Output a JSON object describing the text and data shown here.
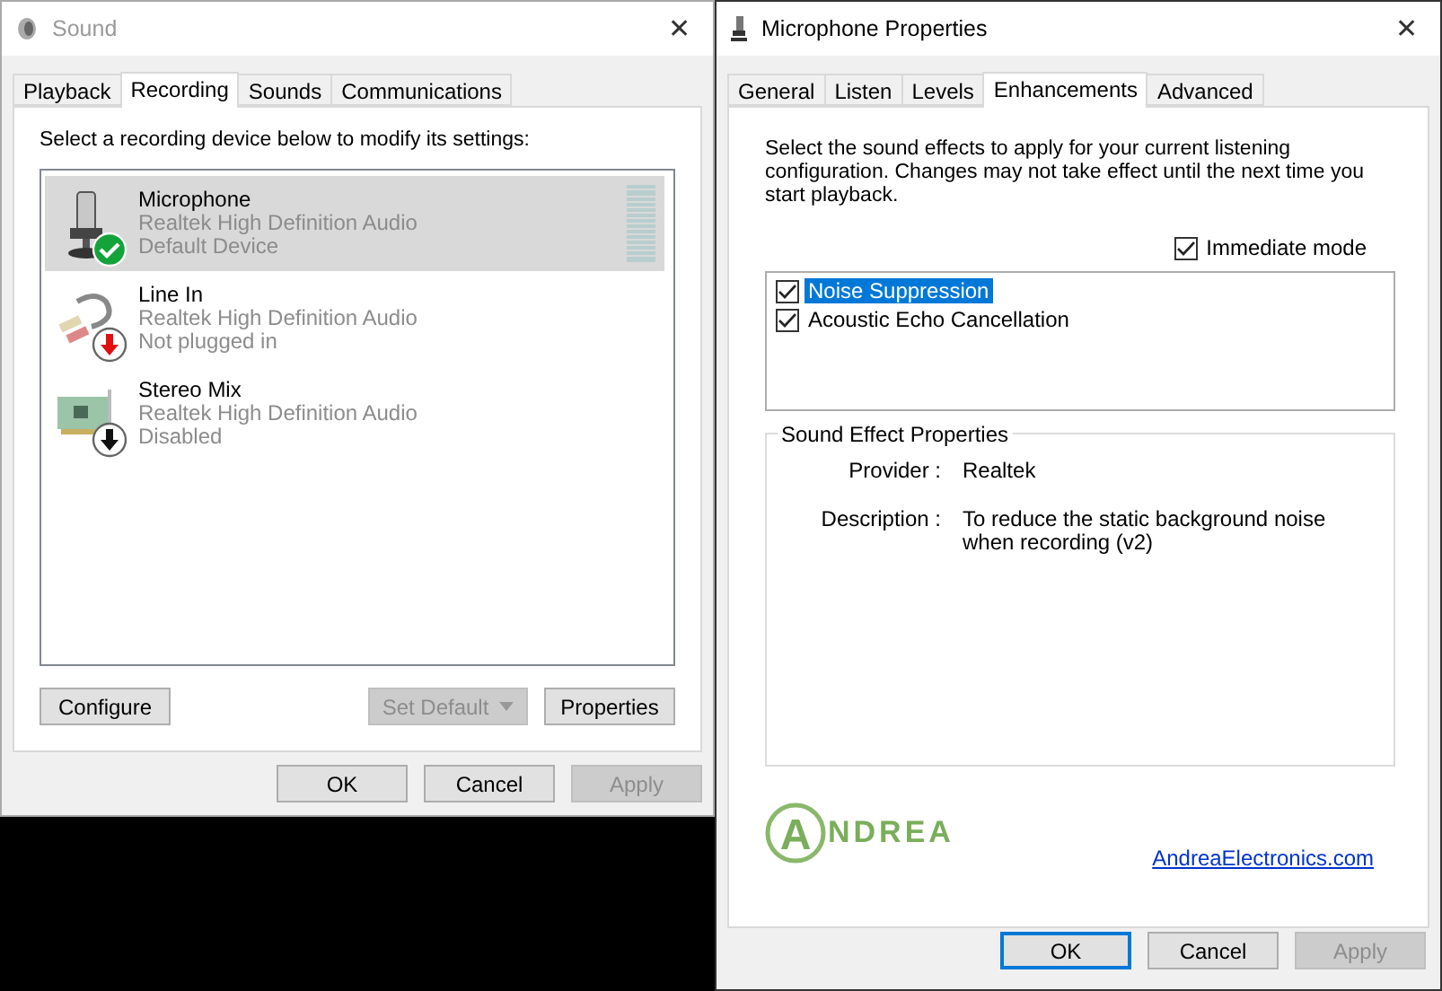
{
  "sound_window": {
    "title": "Sound",
    "close": "✕",
    "tabs": [
      {
        "label": "Playback",
        "selected": false
      },
      {
        "label": "Recording",
        "selected": true
      },
      {
        "label": "Sounds",
        "selected": false
      },
      {
        "label": "Communications",
        "selected": false
      }
    ],
    "instruction": "Select a recording device below to modify its settings:",
    "devices": [
      {
        "name": "Microphone",
        "driver": "Realtek High Definition Audio",
        "status": "Default Device",
        "kind": "microphone",
        "default": true,
        "unplugged": false,
        "disabled": false,
        "selected": true
      },
      {
        "name": "Line In",
        "driver": "Realtek High Definition Audio",
        "status": "Not plugged in",
        "kind": "line",
        "default": false,
        "unplugged": true,
        "disabled": false,
        "selected": false
      },
      {
        "name": "Stereo Mix",
        "driver": "Realtek High Definition Audio",
        "status": "Disabled",
        "kind": "card",
        "default": false,
        "unplugged": false,
        "disabled": true,
        "selected": false
      }
    ],
    "list_buttons": [
      {
        "label": "Configure",
        "disabled": false,
        "kind": "plain"
      },
      {
        "label": "Set Default",
        "disabled": true,
        "kind": "split"
      },
      {
        "label": "Properties",
        "disabled": false,
        "kind": "plain"
      }
    ],
    "buttons": [
      {
        "label": "OK",
        "disabled": false,
        "default": false
      },
      {
        "label": "Cancel",
        "disabled": false,
        "default": false
      },
      {
        "label": "Apply",
        "disabled": true,
        "default": false
      }
    ]
  },
  "properties_window": {
    "title": "Microphone Properties",
    "close": "✕",
    "tabs": [
      {
        "label": "General",
        "selected": false
      },
      {
        "label": "Listen",
        "selected": false
      },
      {
        "label": "Levels",
        "selected": false
      },
      {
        "label": "Enhancements",
        "selected": true
      },
      {
        "label": "Advanced",
        "selected": false
      }
    ],
    "instruction": "Select the sound effects to apply for your current listening configuration. Changes may not take effect until the next time you start playback.",
    "immediate_mode": {
      "label": "Immediate mode",
      "checked": true
    },
    "effects": [
      {
        "label": "Noise Suppression",
        "checked": true,
        "selected": true
      },
      {
        "label": "Acoustic Echo Cancellation",
        "checked": true,
        "selected": false
      }
    ],
    "group": {
      "title": "Sound Effect Properties",
      "fields": [
        {
          "label": "Provider :",
          "value": "Realtek"
        },
        {
          "label": "Description :",
          "value": "To reduce the static background noise when recording (v2)"
        }
      ]
    },
    "logo": {
      "mark": "A",
      "text": "NDREA"
    },
    "link": "AndreaElectronics.com",
    "buttons": [
      {
        "label": "OK",
        "disabled": false,
        "default": true
      },
      {
        "label": "Cancel",
        "disabled": false,
        "default": false
      },
      {
        "label": "Apply",
        "disabled": true,
        "default": false
      }
    ]
  }
}
